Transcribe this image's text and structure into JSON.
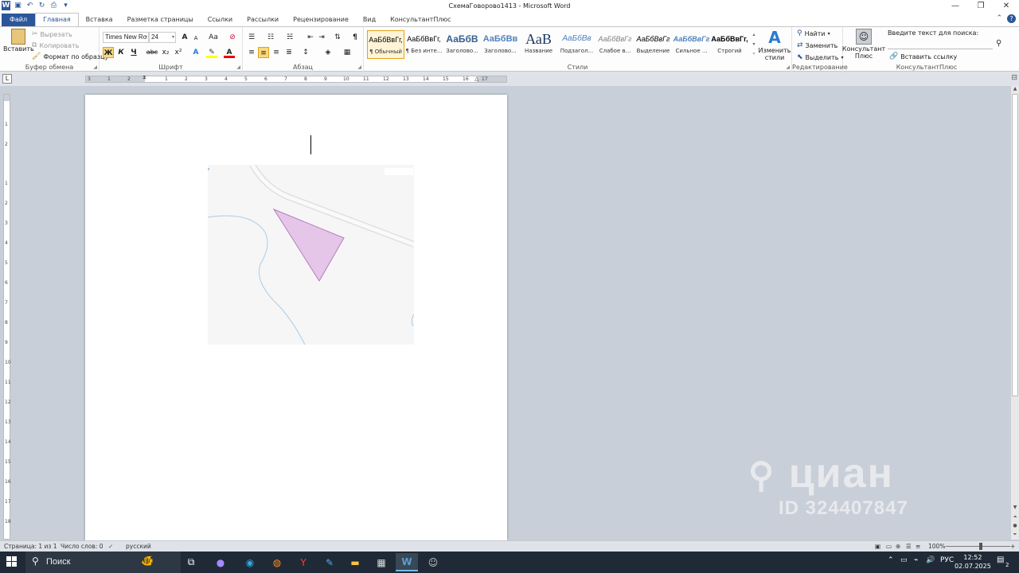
{
  "window": {
    "title": "СхемаГоворово1413 - Microsoft Word"
  },
  "tabs": [
    "Файл",
    "Главная",
    "Вставка",
    "Разметка страницы",
    "Ссылки",
    "Рассылки",
    "Рецензирование",
    "Вид",
    "КонсультантПлюс"
  ],
  "active_tab": "Главная",
  "ribbon": {
    "clipboard": {
      "label": "Буфер обмена",
      "paste": "Вставить",
      "cut": "Вырезать",
      "copy": "Копировать",
      "format_painter": "Формат по образцу"
    },
    "font": {
      "label": "Шрифт",
      "font_name": "Times New Ro",
      "font_size": "24",
      "bold": "Ж",
      "italic": "К",
      "underline": "Ч",
      "strike": "abc",
      "sub": "x₂",
      "sup": "x²",
      "grow": "A",
      "shrink": "A",
      "case": "Aa"
    },
    "paragraph": {
      "label": "Абзац"
    },
    "styles": {
      "label": "Стили",
      "items": [
        {
          "sample": "АаБбВвГг,",
          "name": "¶ Обычный"
        },
        {
          "sample": "АаБбВвГг,",
          "name": "¶ Без инте..."
        },
        {
          "sample": "АаБбВ",
          "name": "Заголово..."
        },
        {
          "sample": "АаБбВв",
          "name": "Заголово..."
        },
        {
          "sample": "АаВ",
          "name": "Название"
        },
        {
          "sample": "АаБбВв",
          "name": "Подзагол..."
        },
        {
          "sample": "АаБбВвГг",
          "name": "Слабое в..."
        },
        {
          "sample": "АаБбВвГг",
          "name": "Выделение"
        },
        {
          "sample": "АаБбВвГг",
          "name": "Сильное ..."
        },
        {
          "sample": "АаБбВвГг,",
          "name": "Строгий"
        }
      ],
      "change_styles": "Изменить стили"
    },
    "editing": {
      "label": "Редактирование",
      "find": "Найти",
      "replace": "Заменить",
      "select": "Выделить"
    },
    "konsultant": {
      "label": "КонсультантПлюс",
      "button": "Консультант Плюс",
      "search_label": "Введите текст для поиска:",
      "insert_link": "Вставить ссылку"
    }
  },
  "ruler": {
    "h_ticks": [
      "3",
      "1",
      "2",
      "1",
      "1",
      "2",
      "3",
      "4",
      "5",
      "6",
      "7",
      "8",
      "9",
      "10",
      "11",
      "12",
      "13",
      "14",
      "15",
      "16",
      "17"
    ],
    "v_ticks": [
      "1",
      "2",
      "1",
      "2",
      "3",
      "4",
      "5",
      "6",
      "7",
      "8",
      "9",
      "10",
      "11",
      "12",
      "13",
      "14",
      "15",
      "16",
      "17",
      "18"
    ]
  },
  "statusbar": {
    "page": "Страница: 1 из 1",
    "words": "Число слов: 0",
    "language": "русский",
    "zoom": "100%"
  },
  "watermark": {
    "brand": "циан",
    "id": "ID 324407847"
  },
  "taskbar": {
    "search": "Поиск",
    "tray_lang": "РУС",
    "time": "12:52",
    "date": "02.07.2025",
    "notifications": "2"
  },
  "colors": {
    "accent": "#2b579a",
    "plot_fill": "#e5c6e8",
    "plot_stroke": "#b67cc0",
    "road": "#e3e3e3",
    "stream": "#a9cde9"
  }
}
